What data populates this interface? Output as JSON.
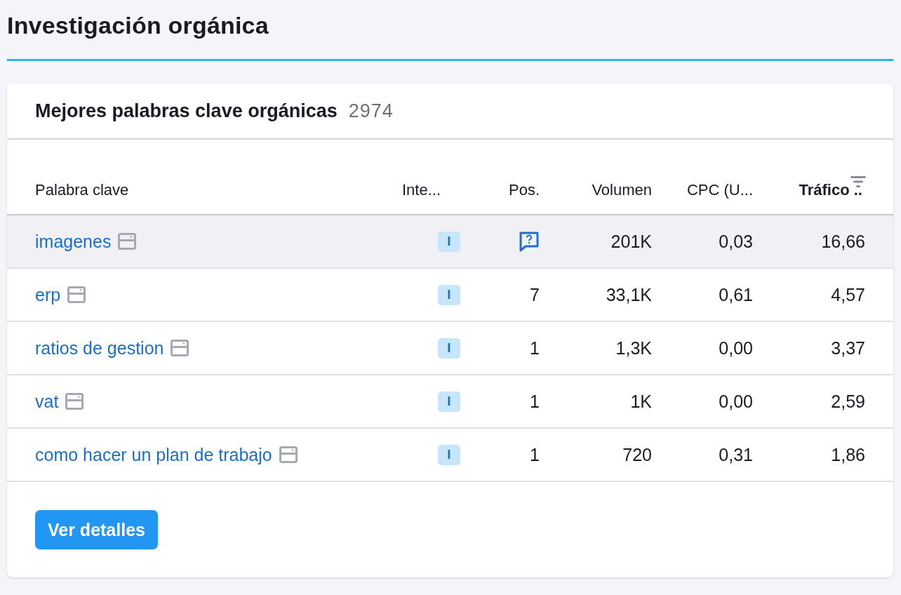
{
  "page_title": "Investigación orgánica",
  "card": {
    "title": "Mejores palabras clave orgánicas",
    "count": "2974"
  },
  "table": {
    "columns": [
      {
        "label": "Palabra clave",
        "sorted": false
      },
      {
        "label": "Inte...",
        "sorted": false
      },
      {
        "label": "Pos.",
        "sorted": false
      },
      {
        "label": "Volumen",
        "sorted": false
      },
      {
        "label": "CPC (U...",
        "sorted": false
      },
      {
        "label": "Tráfico ..",
        "sorted": true
      }
    ],
    "rows": [
      {
        "keyword": "imagenes",
        "intent": "I",
        "position": {
          "kind": "icon"
        },
        "volume": "201K",
        "cpc": "0,03",
        "traffic": "16,66",
        "selected": true
      },
      {
        "keyword": "erp",
        "intent": "I",
        "position": {
          "kind": "number",
          "text": "7"
        },
        "volume": "33,1K",
        "cpc": "0,61",
        "traffic": "4,57",
        "selected": false
      },
      {
        "keyword": "ratios de gestion",
        "intent": "I",
        "position": {
          "kind": "number",
          "text": "1"
        },
        "volume": "1,3K",
        "cpc": "0,00",
        "traffic": "3,37",
        "selected": false
      },
      {
        "keyword": "vat",
        "intent": "I",
        "position": {
          "kind": "number",
          "text": "1"
        },
        "volume": "1K",
        "cpc": "0,00",
        "traffic": "2,59",
        "selected": false
      },
      {
        "keyword": "como hacer un plan de trabajo",
        "intent": "I",
        "position": {
          "kind": "number",
          "text": "1"
        },
        "volume": "720",
        "cpc": "0,31",
        "traffic": "1,86",
        "selected": false
      }
    ]
  },
  "button": "Ver detalles"
}
